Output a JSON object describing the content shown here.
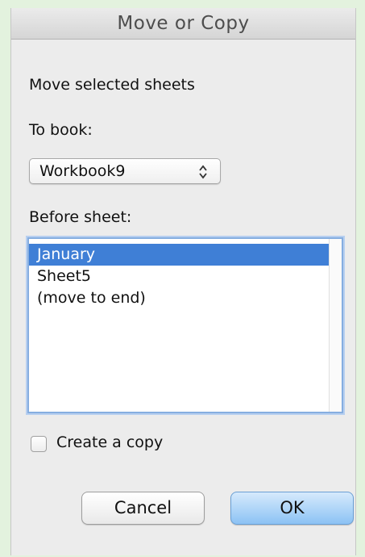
{
  "dialog": {
    "title": "Move or Copy",
    "heading": "Move selected sheets",
    "to_book_label": "To book:",
    "to_book_value": "Workbook9",
    "before_sheet_label": "Before sheet:",
    "sheets": [
      {
        "label": "January",
        "selected": true
      },
      {
        "label": "Sheet5",
        "selected": false
      },
      {
        "label": "(move to end)",
        "selected": false
      }
    ],
    "create_copy_label": "Create a copy",
    "create_copy_checked": false,
    "cancel_label": "Cancel",
    "ok_label": "OK"
  },
  "colors": {
    "selection": "#3f7fd6",
    "default_button": "#8cc2f4",
    "background": "#e3f2de"
  },
  "icons": {
    "popup_arrows": "up-down-chevron-icon"
  }
}
